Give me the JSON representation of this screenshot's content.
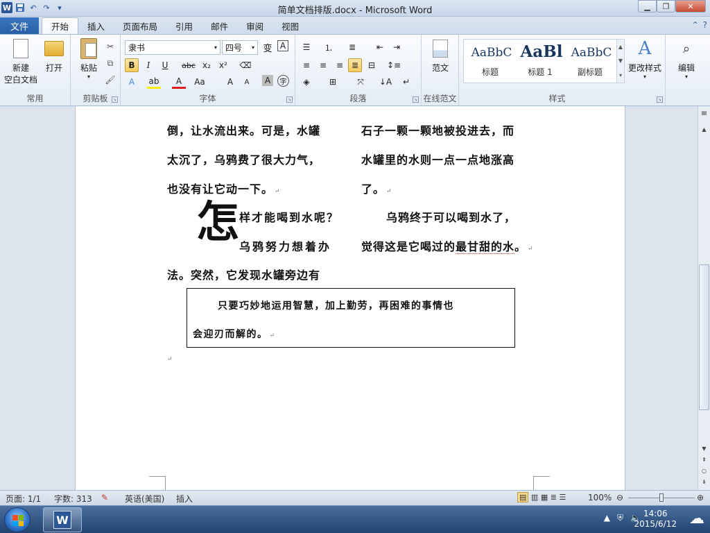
{
  "window": {
    "title": "简单文档排版.docx - Microsoft Word",
    "minimize_icon": "minimize-icon",
    "maximize_icon": "restore-icon",
    "close_icon": "close-icon"
  },
  "quick_access": {
    "items": [
      "word-logo-icon",
      "save-icon",
      "undo-icon",
      "redo-icon",
      "customize-toolbar-icon"
    ]
  },
  "tabs": {
    "file": "文件",
    "items": [
      {
        "label": "开始",
        "active": true
      },
      {
        "label": "插入"
      },
      {
        "label": "页面布局"
      },
      {
        "label": "引用"
      },
      {
        "label": "邮件"
      },
      {
        "label": "审阅"
      },
      {
        "label": "视图"
      }
    ]
  },
  "ribbon": {
    "common": {
      "group_label": "常用",
      "new_label": "新建\n空白文档",
      "new_line1": "新建",
      "new_line2": "空白文档",
      "open_label": "打开"
    },
    "clipboard": {
      "group_label": "剪贴板",
      "paste_label": "粘贴"
    },
    "font": {
      "group_label": "字体",
      "font_name": "隶书",
      "font_size": "四号",
      "buttons": [
        "B",
        "I",
        "U",
        "abc",
        "x₂",
        "x²",
        "Aa",
        "A",
        "A"
      ]
    },
    "paragraph": {
      "group_label": "段落"
    },
    "sample_essay": {
      "group_label": "在线范文",
      "label": "范文"
    },
    "styles": {
      "group_label": "样式",
      "items": [
        {
          "sample": "AaBbC",
          "name": "标题"
        },
        {
          "sample": "AaBl",
          "name": "标题 1"
        },
        {
          "sample": "AaBbC",
          "name": "副标题"
        }
      ],
      "change_styles_label": "更改样式"
    },
    "editing": {
      "label": "编辑"
    }
  },
  "document": {
    "col_left": [
      "倒，让水流出来。可是，水罐",
      "太沉了，乌鸦费了很大力气，",
      "也没有让它动一下。"
    ],
    "col_right": [
      "石子一颗一颗地被投进去，而",
      "水罐里的水则一点一点地涨高",
      "了。"
    ],
    "dropcap": "怎",
    "dropcap_line1": "样才能喝到水呢？",
    "dropcap_line2": "乌鸦努力想着办",
    "left_line4": "法。突然，它发现水罐旁边有",
    "right_line4": "乌鸦终于可以喝到水了，",
    "right_line5_a": "觉得这是它喝过的",
    "right_line5_b": "最甘甜的水",
    "right_line5_c": "。",
    "quote_line1": "只要巧妙地运用智慧，加上勤劳，再困难的事情也",
    "quote_line2": "会迎刃而解的。",
    "return_mark": "↵"
  },
  "status": {
    "page": "页面: 1/1",
    "words": "字数: 313",
    "language": "英语(美国)",
    "mode": "插入",
    "zoom": "100%",
    "zoom_fraction": 0.5
  },
  "taskbar": {
    "time": "14:06",
    "date": "2015/6/12"
  }
}
